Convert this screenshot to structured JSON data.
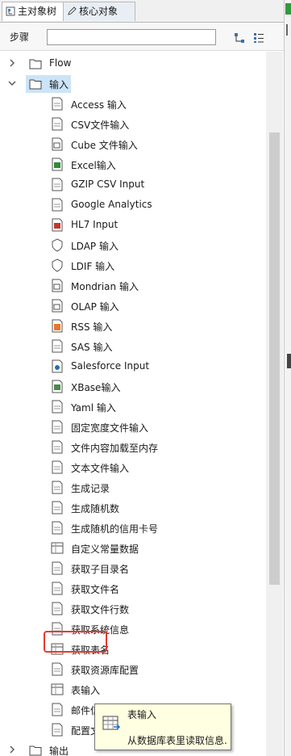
{
  "tabs": [
    {
      "label": "主对象树",
      "icon": "object-tree-icon"
    },
    {
      "label": "核心对象",
      "icon": "pencil-icon"
    }
  ],
  "search": {
    "label": "步骤",
    "value": ""
  },
  "toolbar": {
    "expand_icon": "tree-structure-icon",
    "collapse_icon": "list-icon"
  },
  "tree": {
    "categories": [
      {
        "label": "Flow",
        "expanded": false
      },
      {
        "label": "输入",
        "expanded": true,
        "selected": true
      },
      {
        "label": "输出",
        "expanded": false
      }
    ],
    "input_steps": [
      {
        "label": "Access 输入",
        "icon": "access-icon"
      },
      {
        "label": "CSV文件输入",
        "icon": "csv-file-icon"
      },
      {
        "label": "Cube 文件输入",
        "icon": "cube-file-icon"
      },
      {
        "label": "Excel输入",
        "icon": "excel-icon"
      },
      {
        "label": "GZIP CSV Input",
        "icon": "gzip-csv-icon"
      },
      {
        "label": "Google Analytics",
        "icon": "google-analytics-icon"
      },
      {
        "label": "HL7 Input",
        "icon": "hl7-icon"
      },
      {
        "label": "LDAP 输入",
        "icon": "ldap-shield-icon"
      },
      {
        "label": "LDIF 输入",
        "icon": "ldif-shield-icon"
      },
      {
        "label": "Mondrian 输入",
        "icon": "mondrian-cube-icon"
      },
      {
        "label": "OLAP 输入",
        "icon": "olap-cube-icon"
      },
      {
        "label": "RSS 输入",
        "icon": "rss-icon"
      },
      {
        "label": "SAS 输入",
        "icon": "sas-icon"
      },
      {
        "label": "Salesforce Input",
        "icon": "salesforce-icon"
      },
      {
        "label": "XBase输入",
        "icon": "xbase-icon"
      },
      {
        "label": "Yaml 输入",
        "icon": "yaml-icon"
      },
      {
        "label": "固定宽度文件输入",
        "icon": "fixed-width-file-icon"
      },
      {
        "label": "文件内容加载至内存",
        "icon": "load-file-memory-icon"
      },
      {
        "label": "文本文件输入",
        "icon": "text-file-icon"
      },
      {
        "label": "生成记录",
        "icon": "generate-rows-icon"
      },
      {
        "label": "生成随机数",
        "icon": "random-number-icon"
      },
      {
        "label": "生成随机的信用卡号",
        "icon": "random-credit-card-icon"
      },
      {
        "label": "自定义常量数据",
        "icon": "constant-data-icon"
      },
      {
        "label": "获取子目录名",
        "icon": "subfolder-icon"
      },
      {
        "label": "获取文件名",
        "icon": "get-filename-icon"
      },
      {
        "label": "获取文件行数",
        "icon": "file-rows-count-icon"
      },
      {
        "label": "获取系统信息",
        "icon": "system-info-icon"
      },
      {
        "label": "获取表名",
        "icon": "table-names-icon"
      },
      {
        "label": "获取资源库配置",
        "icon": "repository-config-icon"
      },
      {
        "label": "表输入",
        "icon": "table-input-icon",
        "highlighted": true
      },
      {
        "label": "邮件信息输入",
        "icon": "email-icon"
      },
      {
        "label": "配置文件输入",
        "icon": "config-file-icon"
      }
    ]
  },
  "tooltip": {
    "title": "表输入",
    "description": "从数据库表里读取信息."
  },
  "colors": {
    "selection": "#cce4f7",
    "highlight_border": "#e53b2f",
    "tooltip_bg": "#ffffe1",
    "status_green": "#2e9a3c"
  }
}
